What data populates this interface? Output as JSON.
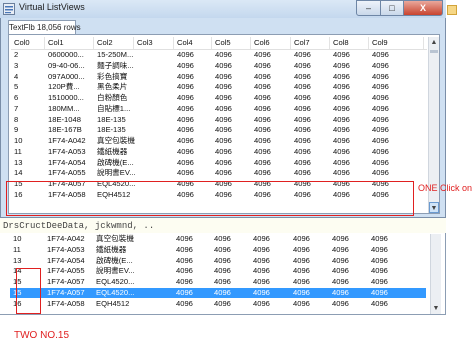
{
  "window": {
    "title": "Virtual ListViews",
    "tab_label": "TextFlb 18,056 rows",
    "minimize": "–",
    "maximize": "□",
    "close": "X"
  },
  "columns": [
    "Col0",
    "Col1",
    "Col2",
    "Col3",
    "Col4",
    "Col5",
    "Col6",
    "Col7",
    "Col8",
    "Col9"
  ],
  "list1": {
    "rows": [
      [
        "2",
        "0600000...",
        "15-250M...",
        "",
        "4096",
        "4096",
        "4096",
        "4096",
        "4096",
        "4096"
      ],
      [
        "3",
        "09-40-06...",
        "麵子調味...",
        "",
        "4096",
        "4096",
        "4096",
        "4096",
        "4096",
        "4096"
      ],
      [
        "4",
        "097A000...",
        "彩色搞寶",
        "",
        "4096",
        "4096",
        "4096",
        "4096",
        "4096",
        "4096"
      ],
      [
        "5",
        "120P費...",
        "黑色柔片",
        "",
        "4096",
        "4096",
        "4096",
        "4096",
        "4096",
        "4096"
      ],
      [
        "6",
        "1510000...",
        "白粉顏色",
        "",
        "4096",
        "4096",
        "4096",
        "4096",
        "4096",
        "4096"
      ],
      [
        "7",
        "180MM...",
        "自貼標1...",
        "",
        "4096",
        "4096",
        "4096",
        "4096",
        "4096",
        "4096"
      ],
      [
        "8",
        "18E-1048",
        "18E-135",
        "",
        "4096",
        "4096",
        "4096",
        "4096",
        "4096",
        "4096"
      ],
      [
        "9",
        "18E-167B",
        "18E-135",
        "",
        "4096",
        "4096",
        "4096",
        "4096",
        "4096",
        "4096"
      ],
      [
        "10",
        "1F74-A042",
        "真空包裝機",
        "",
        "4096",
        "4096",
        "4096",
        "4096",
        "4096",
        "4096"
      ],
      [
        "11",
        "1F74-A053",
        "鐵紙機器",
        "",
        "4096",
        "4096",
        "4096",
        "4096",
        "4096",
        "4096"
      ],
      [
        "13",
        "1F74-A054",
        "啟碑機(E...",
        "",
        "4096",
        "4096",
        "4096",
        "4096",
        "4096",
        "4096"
      ],
      [
        "14",
        "1F74-A055",
        "說明書EV...",
        "",
        "4096",
        "4096",
        "4096",
        "4096",
        "4096",
        "4096"
      ],
      [
        "15",
        "1F74-A057",
        "EQL4520...",
        "",
        "4096",
        "4096",
        "4096",
        "4096",
        "4096",
        "4096"
      ],
      [
        "16",
        "1F74-A058",
        "EQH4512",
        "",
        "4096",
        "4096",
        "4096",
        "4096",
        "4096",
        "4096"
      ]
    ]
  },
  "editor_line": "DrsCructDeeData, jckwmnd, ..",
  "list2": {
    "selected_index": 5,
    "rows": [
      [
        "10",
        "1F74-A042",
        "真空包裝機",
        "",
        "4096",
        "4096",
        "4096",
        "4096",
        "4096",
        "4096"
      ],
      [
        "11",
        "1F74-A053",
        "鐵紙機器",
        "",
        "4096",
        "4096",
        "4096",
        "4096",
        "4096",
        "4096"
      ],
      [
        "13",
        "1F74-A054",
        "啟碑機(E...",
        "",
        "4096",
        "4096",
        "4096",
        "4096",
        "4096",
        "4096"
      ],
      [
        "14",
        "1F74-A055",
        "說明書EV...",
        "",
        "4096",
        "4096",
        "4096",
        "4096",
        "4096",
        "4096"
      ],
      [
        "15",
        "1F74-A057",
        "EQL4520...",
        "",
        "4096",
        "4096",
        "4096",
        "4096",
        "4096",
        "4096"
      ],
      [
        "15",
        "1F74-A057",
        "EQL4520...",
        "",
        "4096",
        "4096",
        "4096",
        "4096",
        "4096",
        "4096"
      ],
      [
        "16",
        "1F74-A058",
        "EQH4512",
        "",
        "4096",
        "4096",
        "4096",
        "4096",
        "4096",
        "4096"
      ]
    ]
  },
  "annotations": {
    "one_click": "ONE Click on",
    "two": "TWO  NO.15",
    "color": "#e02020"
  },
  "selection_color": "#3399ff",
  "scroll_up_icon": "triangle-up",
  "scroll_down_icon": "triangle-down"
}
